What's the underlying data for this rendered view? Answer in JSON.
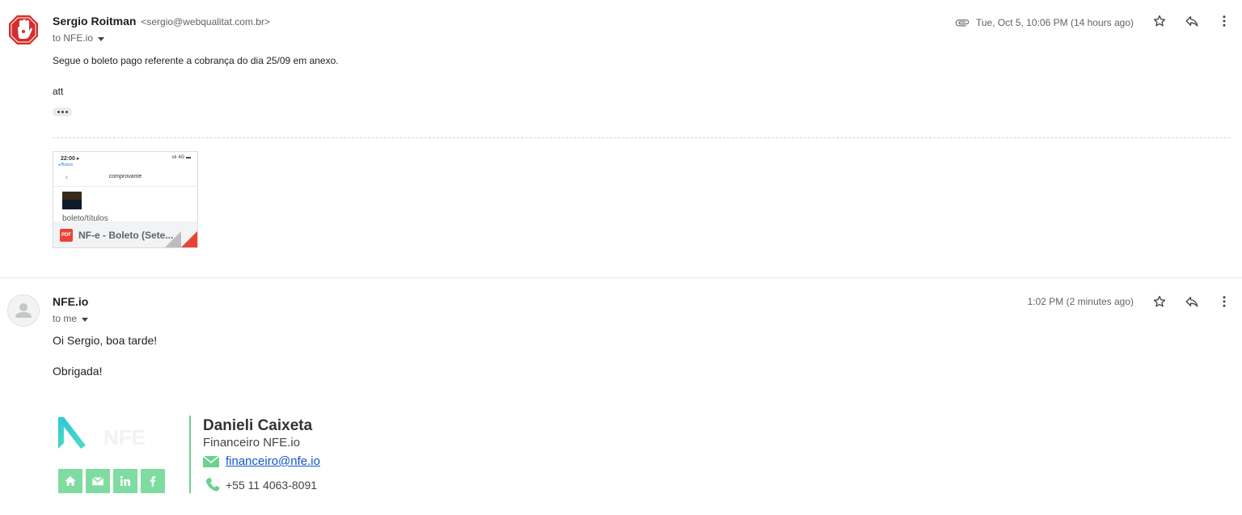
{
  "colors": {
    "accent_red": "#ea4335",
    "signature_green": "#6cd18e",
    "link_blue": "#1155cc",
    "secondary_text": "#5f6368"
  },
  "message1": {
    "sender_name": "Sergio Roitman",
    "sender_email": "<sergio@webqualitat.com.br>",
    "to": "to NFE.io",
    "timestamp": "Tue, Oct 5, 10:06 PM (14 hours ago)",
    "body_line1": "Segue o boleto pago referente a cobrança do dia 25/09 em anexo.",
    "body_line2": "att",
    "attachment": {
      "name": "NF-e - Boleto (Sete...",
      "type_badge": "PDF",
      "preview": {
        "status_time": "22:00 ▸",
        "status_right": "ıılı 4G ▬",
        "back_label": "◂ Busca",
        "title": "comprovante",
        "caption": "boleto/títulos"
      }
    },
    "icons": [
      "paperclip-icon",
      "star-icon",
      "reply-icon",
      "more-vert-icon"
    ]
  },
  "message2": {
    "sender_name": "NFE.io",
    "to": "to me",
    "timestamp": "1:02 PM (2 minutes ago)",
    "greeting": "Oi Sergio, boa tarde!",
    "thanks": "Obrigada!",
    "signature": {
      "name": "Danieli Caixeta",
      "role": "Financeiro NFE.io",
      "email": "financeiro@nfe.io",
      "phone": "+55 11 4063-8091",
      "socials": [
        "home-icon",
        "mail-icon",
        "linkedin-icon",
        "facebook-icon"
      ]
    },
    "icons": [
      "star-icon",
      "reply-icon",
      "more-vert-icon"
    ]
  }
}
